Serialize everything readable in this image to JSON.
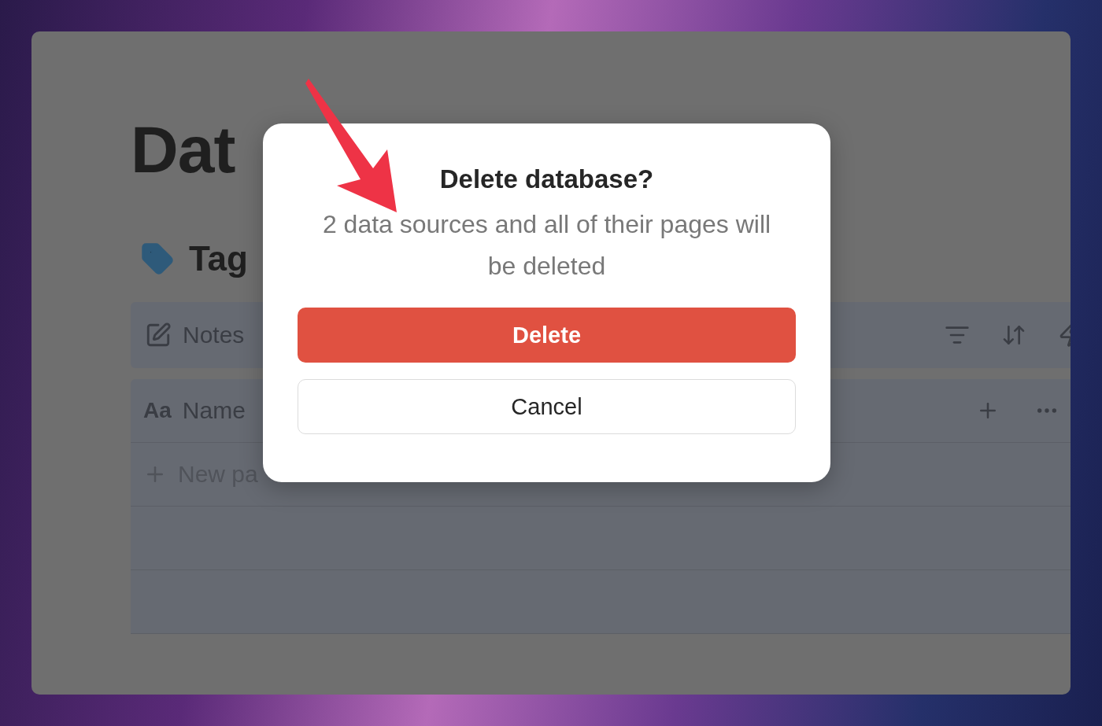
{
  "page": {
    "title": "Dat",
    "section_title": "Tag",
    "view_tab": "Notes",
    "table": {
      "columns": [
        {
          "icon_text": "Aa",
          "label": "Name"
        }
      ],
      "rows": [
        {
          "label": "New pa"
        }
      ]
    }
  },
  "dialog": {
    "title": "Delete database?",
    "message": "2 data sources and all of their pages will be deleted",
    "buttons": [
      {
        "label": "Delete",
        "kind": "danger"
      },
      {
        "label": "Cancel",
        "kind": "secondary"
      }
    ]
  }
}
